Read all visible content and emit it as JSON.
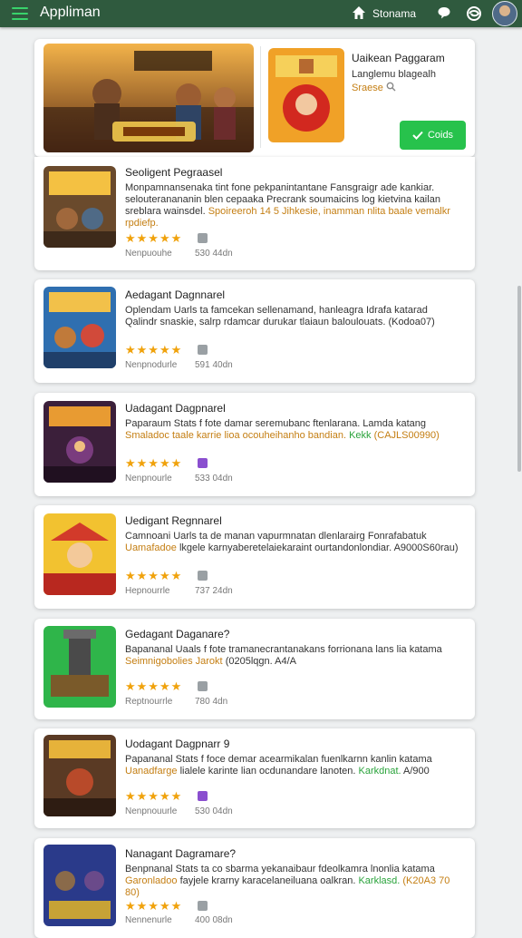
{
  "header": {
    "app_title": "Appliman",
    "home_label": "Stonama"
  },
  "hero": {
    "title": "Uaikean Paggaram",
    "subtitle": "Langlemu blagealh",
    "tag": "Sraese",
    "button_label": "Coids"
  },
  "apps": [
    {
      "title": "Seoligent Pegraasel",
      "desc_plain": "Monpamnansenaka tint fone pekpanintantane Fansgraigr ade kankiar. selouteranananin blen cepaaka Precrank soumaicins log kietvina kailan sreblara wainsdel.",
      "desc_highlight": "Spoireeroh 14 5 Jihkesie, inamman nlita baale vemalkr rpdiefp.",
      "desc_green": "",
      "rating": "★★★★★",
      "meta_label": "Nenpuouhe",
      "meta_size": "530 44dn"
    },
    {
      "title": "Aedagant Dagnnarel",
      "desc_plain": "Oplendam Uarls ta famcekan sellenamand, hanleagra Idrafa katarad Qalindr snaskie, salrp rdamcar durukar tlaiaun baloulouats.",
      "desc_highlight": "",
      "desc_green": "",
      "desc_extra": "(Kodoa07)",
      "rating": "★★★★★",
      "meta_label": "Nenpnodurle",
      "meta_size": "591 40dn"
    },
    {
      "title": "Uadagant Dagpnarel",
      "desc_plain": "Paparaum Stats f fote damar seremubanc ftenlarana. Lamda katang",
      "desc_highlight": "Smaladoc taale karrie lioa ocouheihanho bandian.",
      "desc_green": "Kekk",
      "desc_extra": "(CAJLS00990)",
      "rating": "★★★★★",
      "meta_label": "Nenpnourle",
      "meta_size": "533 04dn"
    },
    {
      "title": "Uedigant Regnnarel",
      "desc_plain": "Camnoani Uarls ta de manan vapurmnatan dlenlarairg Fonrafabatuk",
      "desc_highlight": "Uamafadoe",
      "desc_green": "",
      "desc_extra_inline": "lkgele karnyaberetelaiekaraint ourtandonlondiar. A9000S60rau)",
      "rating": "★★★★★",
      "meta_label": "Hepnourrle",
      "meta_size": "737 24dn"
    },
    {
      "title": "Gedagant Daganare?",
      "desc_plain": "Bapananal Uaals f fote tramanecrantanakans forrionana lans lia katama",
      "desc_highlight": "Seimnigobolies Jarokt",
      "desc_green": "",
      "desc_extra_inline": "(0205lqgn. A4/A",
      "rating": "★★★★★",
      "meta_label": "Reptnourrle",
      "meta_size": "780 4dn"
    },
    {
      "title": "Uodagant Dagpnarr 9",
      "desc_plain": "Papananal Stats f foce demar acearmikalan fuenlkarnn kanlin katama",
      "desc_highlight": "Uanadfarge",
      "desc_green": "Karkdnat.",
      "desc_extra_inline": "lialele karinte lian ocdunandare lanoten.",
      "desc_extra": "A/900",
      "rating": "★★★★★",
      "meta_label": "Nenpnouurle",
      "meta_size": "530 04dn"
    },
    {
      "title": "Nanagant Dagramare?",
      "desc_plain": "Benpnanal Stats ta co sbarma yekanaibaur fdeolkamra lnonlia katama",
      "desc_highlight": "Garonladoo",
      "desc_green": "Karklasd.",
      "desc_extra_inline": "fayjele krarny karacelaneiluana oalkran.",
      "desc_extra": "(K20A3 70 80)",
      "rating": "★★★★★",
      "meta_label": "Nennenurle",
      "meta_size": "400 08dn"
    }
  ]
}
